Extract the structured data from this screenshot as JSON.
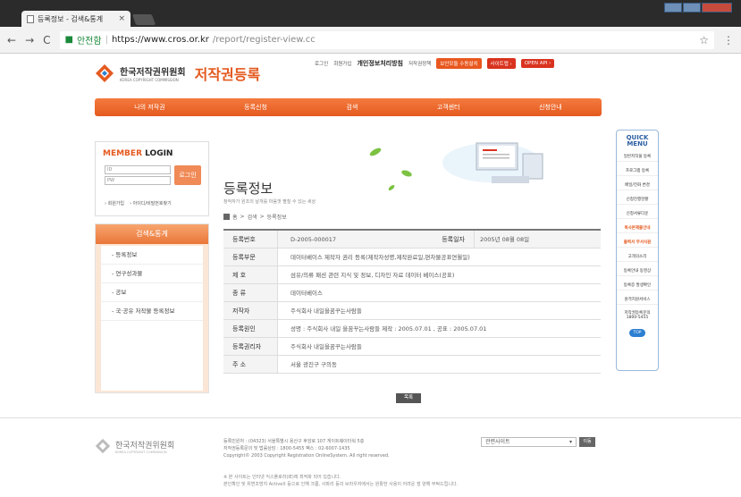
{
  "browser": {
    "tab_title": "등록정보 - 검색&통계",
    "tab_close": "×",
    "secure_label": "안전함",
    "url_host": "https://www.cros.or.kr",
    "url_path": "/report/register-view.cc",
    "back": "←",
    "forward": "→",
    "reload": "C"
  },
  "header": {
    "org_name_ko": "한국저작권위원회",
    "org_name_en": "KOREA COPYRIGHT COMMISSION",
    "site_title": "저작권등록",
    "links": [
      "로그인",
      "회원가입",
      "개인정보처리방침",
      "저작권정책"
    ],
    "pills": [
      "보안모듈 수동설치",
      "사이트맵 ›",
      "OPEN API ›"
    ]
  },
  "gnb": [
    "나의 저작권",
    "등록신청",
    "검색",
    "고객센터",
    "신청안내"
  ],
  "login": {
    "title_a": "MEMBER",
    "title_b": " LOGIN",
    "id_placeholder": "ID",
    "pw_placeholder": "PW",
    "button": "로그인",
    "join": "› 회원가입",
    "find": "› 아이디/비밀번호찾기"
  },
  "lnb": {
    "title": "검색&통계",
    "items": [
      "등록정보",
      "연구성과물",
      "공보",
      "국·공유 저작물 등록정보"
    ]
  },
  "main": {
    "title": "등록정보",
    "subtitle": "창작자가 원조의 날개를 마음껏 펼칠 수 있는 세상",
    "breadcrumb": [
      "홈",
      "검색",
      "등록정보"
    ],
    "reg_no_label": "등록번호",
    "reg_no": "D-2005-000017",
    "reg_date_label": "등록일자",
    "reg_date": "2005년 08월 08일",
    "rows": [
      {
        "label": "등록부문",
        "value": "데이터베이스 제작자 권리 등록(제작자성명,제작완료일,편차물공표연월일)"
      },
      {
        "label": "제 호",
        "value": "섬유/의류 패션 관련 지식 및 정보, 디자인 자료 데이터 베이스(공표)"
      },
      {
        "label": "종 류",
        "value": "데이터베이스"
      },
      {
        "label": "저작자",
        "value": "주식회사 내일을꿈꾸는사람들"
      },
      {
        "label": "등록원인",
        "value": "성명 : 주식회사 내일 을꿈꾸는사람들 제작 : 2005.07.01 , 공표 : 2005.07.01"
      },
      {
        "label": "등록권리자",
        "value": "주식회사 내일을꿈꾸는사람들"
      },
      {
        "label": "주 소",
        "value": "서울 광진구 구의동"
      }
    ],
    "list_button": "목록"
  },
  "quick": {
    "title_a": "QUICK",
    "title_b": "MENU",
    "items": [
      "일반저작물 등록",
      "프로그램 등록",
      "배일/전화 변경",
      "신청진행현황",
      "신청서류다운",
      "복사본제출안내",
      "출력서 무서식원",
      "고객의소리",
      "등록안내 동영상",
      "등록증 발생확인",
      "원격지원서비스"
    ],
    "highlight": [
      5,
      6
    ],
    "phone_label": "저작권등록문의",
    "phone": "1800-5455",
    "top": "TOP"
  },
  "footer": {
    "org_name": "한국저작권위원회",
    "org_en": "KOREA COPYRIGHT COMMISSION",
    "info_lines": [
      "등록민원처 : (04323) 서울특별시 용산구 후암로 107 게이트웨이타워 5층",
      "저작권등록문의 및 법률상담 : 1800-5455  팩스 : 02-6007-1435",
      "Copyright© 2003 Copyright Registration OnlineSystem. All right reserved."
    ],
    "select": "관련사이트",
    "go": "이동",
    "notes": [
      "※ 본 사이트는 인터넷 익스플로러(IE)에 최적화 되어 있습니다.",
      "본인확인 및 위변조방지 ActiveX 등으로 인해 크롬, 사파리 등의 브라우저에서는 원활한 사용이 어려운 점 양해 부탁드립니다."
    ]
  }
}
